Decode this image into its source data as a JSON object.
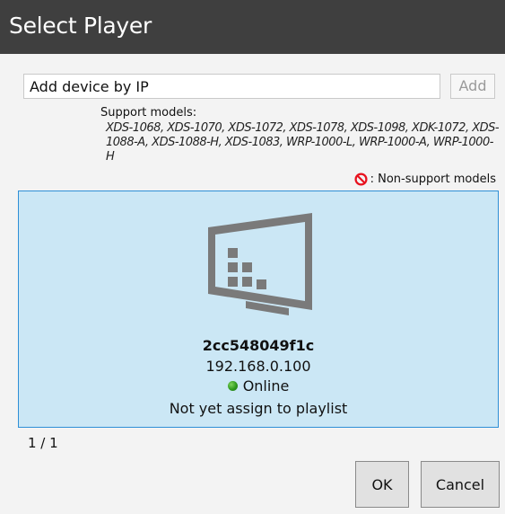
{
  "window": {
    "title": "Select Player"
  },
  "add_device": {
    "placeholder": "Add device by IP",
    "add_label": "Add"
  },
  "support": {
    "heading": "Support models:",
    "models": "XDS-1068, XDS-1070, XDS-1072, XDS-1078, XDS-1098, XDK-1072, XDS-1088-A, XDS-1088-H, XDS-1083, WRP-1000-L, WRP-1000-A, WRP-1000-H",
    "nonsupport_label": ": Non-support models"
  },
  "player": {
    "icon": "monitor-icon",
    "name": "2cc548049f1c",
    "ip": "192.168.0.100",
    "status": "Online",
    "status_color": "#2f9a1d",
    "playlist_text": "Not yet assign to playlist",
    "selected": true
  },
  "pagination": {
    "text": "1 / 1"
  },
  "footer": {
    "ok_label": "OK",
    "cancel_label": "Cancel"
  },
  "colors": {
    "titlebar": "#3f3f3f",
    "selection_fill": "#cbe7f5",
    "selection_border": "#2e8fd6",
    "ban_icon": "#e8121e"
  }
}
